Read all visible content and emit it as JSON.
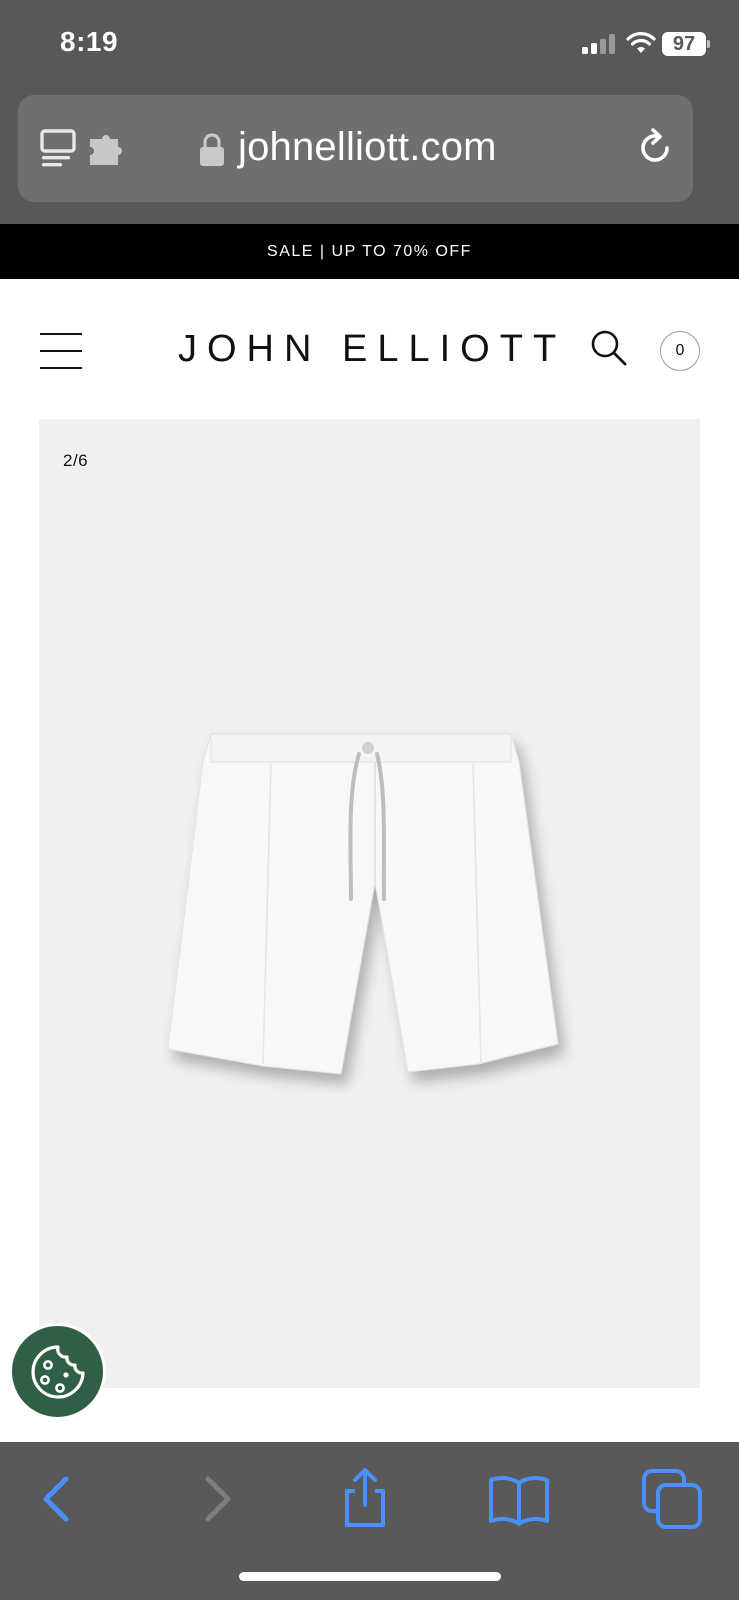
{
  "status_bar": {
    "time": "8:19",
    "battery": "97",
    "icons": [
      "signal-icon",
      "wifi-icon",
      "battery-icon"
    ]
  },
  "browser": {
    "url": "johnelliott.com",
    "icons": [
      "reader-icon",
      "extension-icon",
      "lock-icon",
      "reload-icon"
    ]
  },
  "promo": {
    "text": "SALE | UP TO 70% OFF"
  },
  "header": {
    "brand": "JOHN ELLIOTT",
    "cart_count": "0",
    "icons": [
      "menu-icon",
      "search-icon"
    ]
  },
  "gallery": {
    "counter": "2/6",
    "image": "white-pleated-shorts-image"
  },
  "cookie": {
    "icon": "cookie-icon",
    "color": "#2f5f45"
  },
  "toolbar": {
    "icons": [
      "back-icon",
      "forward-icon",
      "share-icon",
      "bookmarks-icon",
      "tabs-icon"
    ],
    "accent": "#4a90ff"
  }
}
